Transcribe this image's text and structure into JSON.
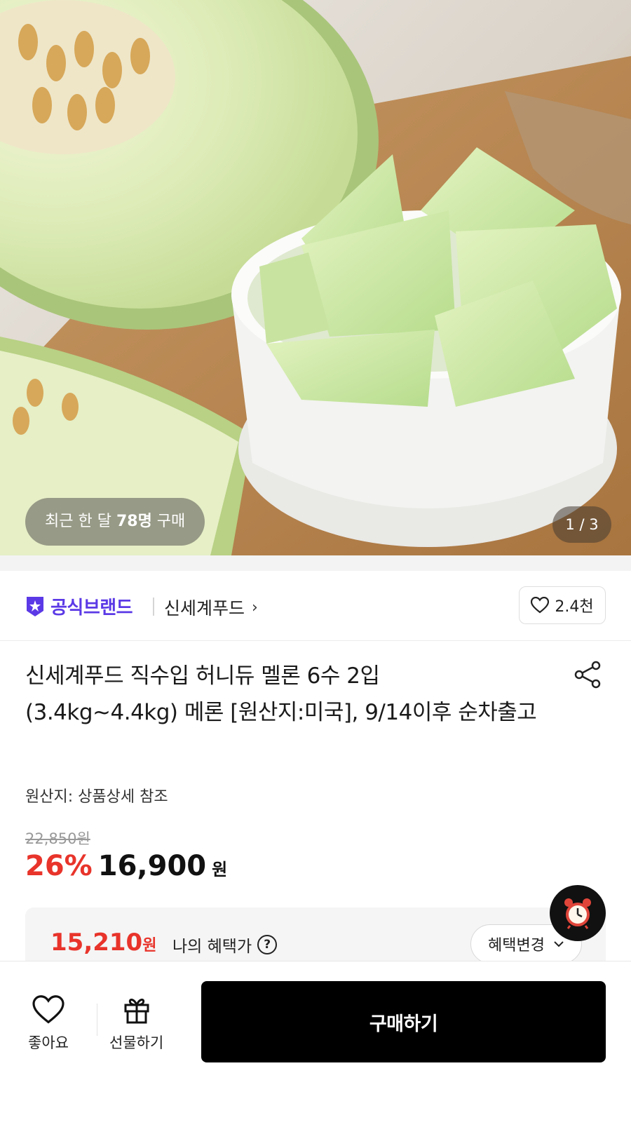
{
  "hero": {
    "recent_purchase_prefix": "최근 한 달 ",
    "recent_purchase_count": "78명",
    "recent_purchase_suffix": " 구매",
    "image_counter": "1 / 3"
  },
  "brand": {
    "official_label": "공식브랜드",
    "official_icon": "star-badge-icon",
    "name": "신세계푸드",
    "chevron": "›",
    "like_count": "2.4천",
    "accent_color": "#5b39e6"
  },
  "product": {
    "title": "신세계푸드 직수입 허니듀 멜론 6수 2입 (3.4kg~4.4kg) 메론 [원산지:미국], 9/14이후 순차출고",
    "origin": "원산지: 상품상세 참조",
    "original_price": "22,850원",
    "discount_rate": "26%",
    "sale_price": "16,900",
    "currency": "원",
    "discount_color": "#e8342b"
  },
  "benefit": {
    "price": "15,210",
    "currency": "원",
    "label": "나의 혜택가",
    "help_icon": "?",
    "change_button": "혜택변경"
  },
  "bottom_bar": {
    "like_label": "좋아요",
    "gift_label": "선물하기",
    "buy_label": "구매하기"
  }
}
